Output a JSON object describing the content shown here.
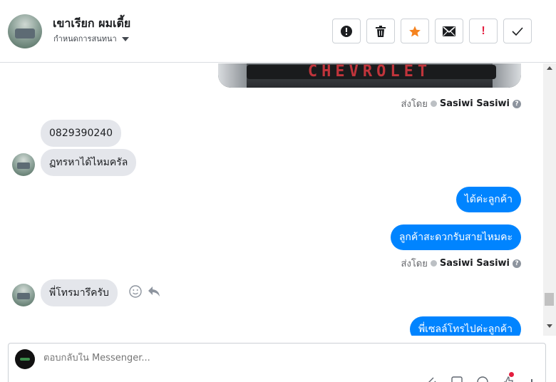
{
  "header": {
    "contact_name": "เขาเรียก ผมเตี้ย",
    "subtitle": "กำหนดการสนทนา"
  },
  "toolbar": {
    "buttons": [
      {
        "name": "spam-icon"
      },
      {
        "name": "trash-icon"
      },
      {
        "name": "star-icon",
        "color": "#f5831f"
      },
      {
        "name": "mail-icon"
      },
      {
        "name": "important-icon",
        "label": "!",
        "color": "#e41e3f"
      },
      {
        "name": "check-icon"
      }
    ]
  },
  "conversation": {
    "image_text": "CHEVROLET",
    "sent_by_prefix": "ส่งโดย",
    "sent_by_name": "Sasiwi Sasiwi",
    "help_glyph": "?",
    "incoming_1": "0829390240",
    "incoming_2": "ฏทรหาได้ไหมครัล",
    "outgoing_1": "ได้ค่ะลูกค้า",
    "outgoing_2": "ลูกค้าสะดวกรับสายไหมคะ",
    "incoming_3": "พี่โทรมารึครับ",
    "outgoing_3": "พี่เซลล์โทรไปค่ะลูกค้า"
  },
  "composer": {
    "placeholder": "ตอบกลับใน Messenger..."
  },
  "colors": {
    "outgoing_bubble": "#0084ff",
    "incoming_bubble": "#e4e6eb"
  }
}
